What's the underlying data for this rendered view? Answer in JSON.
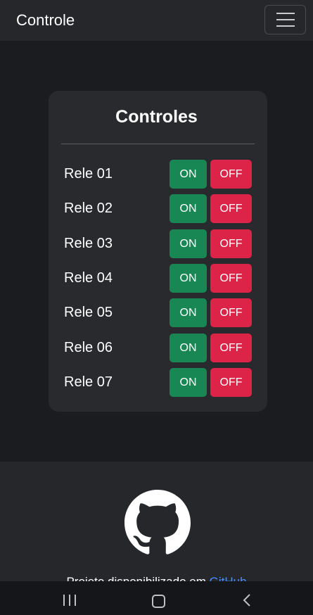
{
  "navbar": {
    "brand": "Controle"
  },
  "card": {
    "title": "Controles",
    "relays": [
      {
        "label": "Rele 01",
        "on_label": "ON",
        "off_label": "OFF"
      },
      {
        "label": "Rele 02",
        "on_label": "ON",
        "off_label": "OFF"
      },
      {
        "label": "Rele 03",
        "on_label": "ON",
        "off_label": "OFF"
      },
      {
        "label": "Rele 04",
        "on_label": "ON",
        "off_label": "OFF"
      },
      {
        "label": "Rele 05",
        "on_label": "ON",
        "off_label": "OFF"
      },
      {
        "label": "Rele 06",
        "on_label": "ON",
        "off_label": "OFF"
      },
      {
        "label": "Rele 07",
        "on_label": "ON",
        "off_label": "OFF"
      }
    ]
  },
  "footer": {
    "text": "Projeto disponibilizado em",
    "link_text": "GitHub",
    "icon": "github-icon"
  },
  "colors": {
    "background": "#1b1c20",
    "navbar": "#25272b",
    "card": "#282a2e",
    "on_button": "#198754",
    "off_button": "#dc2348",
    "link": "#4c8dff"
  },
  "system_nav": {
    "icons": [
      "recents-icon",
      "home-icon",
      "back-icon"
    ]
  }
}
